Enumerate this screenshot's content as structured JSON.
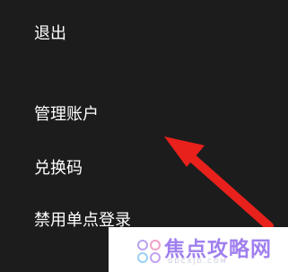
{
  "menu": {
    "items": [
      {
        "label": "退出"
      },
      {
        "label": "管理账户"
      },
      {
        "label": "兑换码"
      },
      {
        "label": "禁用单点登录"
      }
    ]
  },
  "watermark": {
    "title": "焦点攻略网",
    "url": "GDCXJD.COM"
  },
  "colors": {
    "background": "#1c1c1c",
    "text": "#ffffff",
    "arrow": "#e8211c",
    "watermark_accent": "#a080ee"
  }
}
